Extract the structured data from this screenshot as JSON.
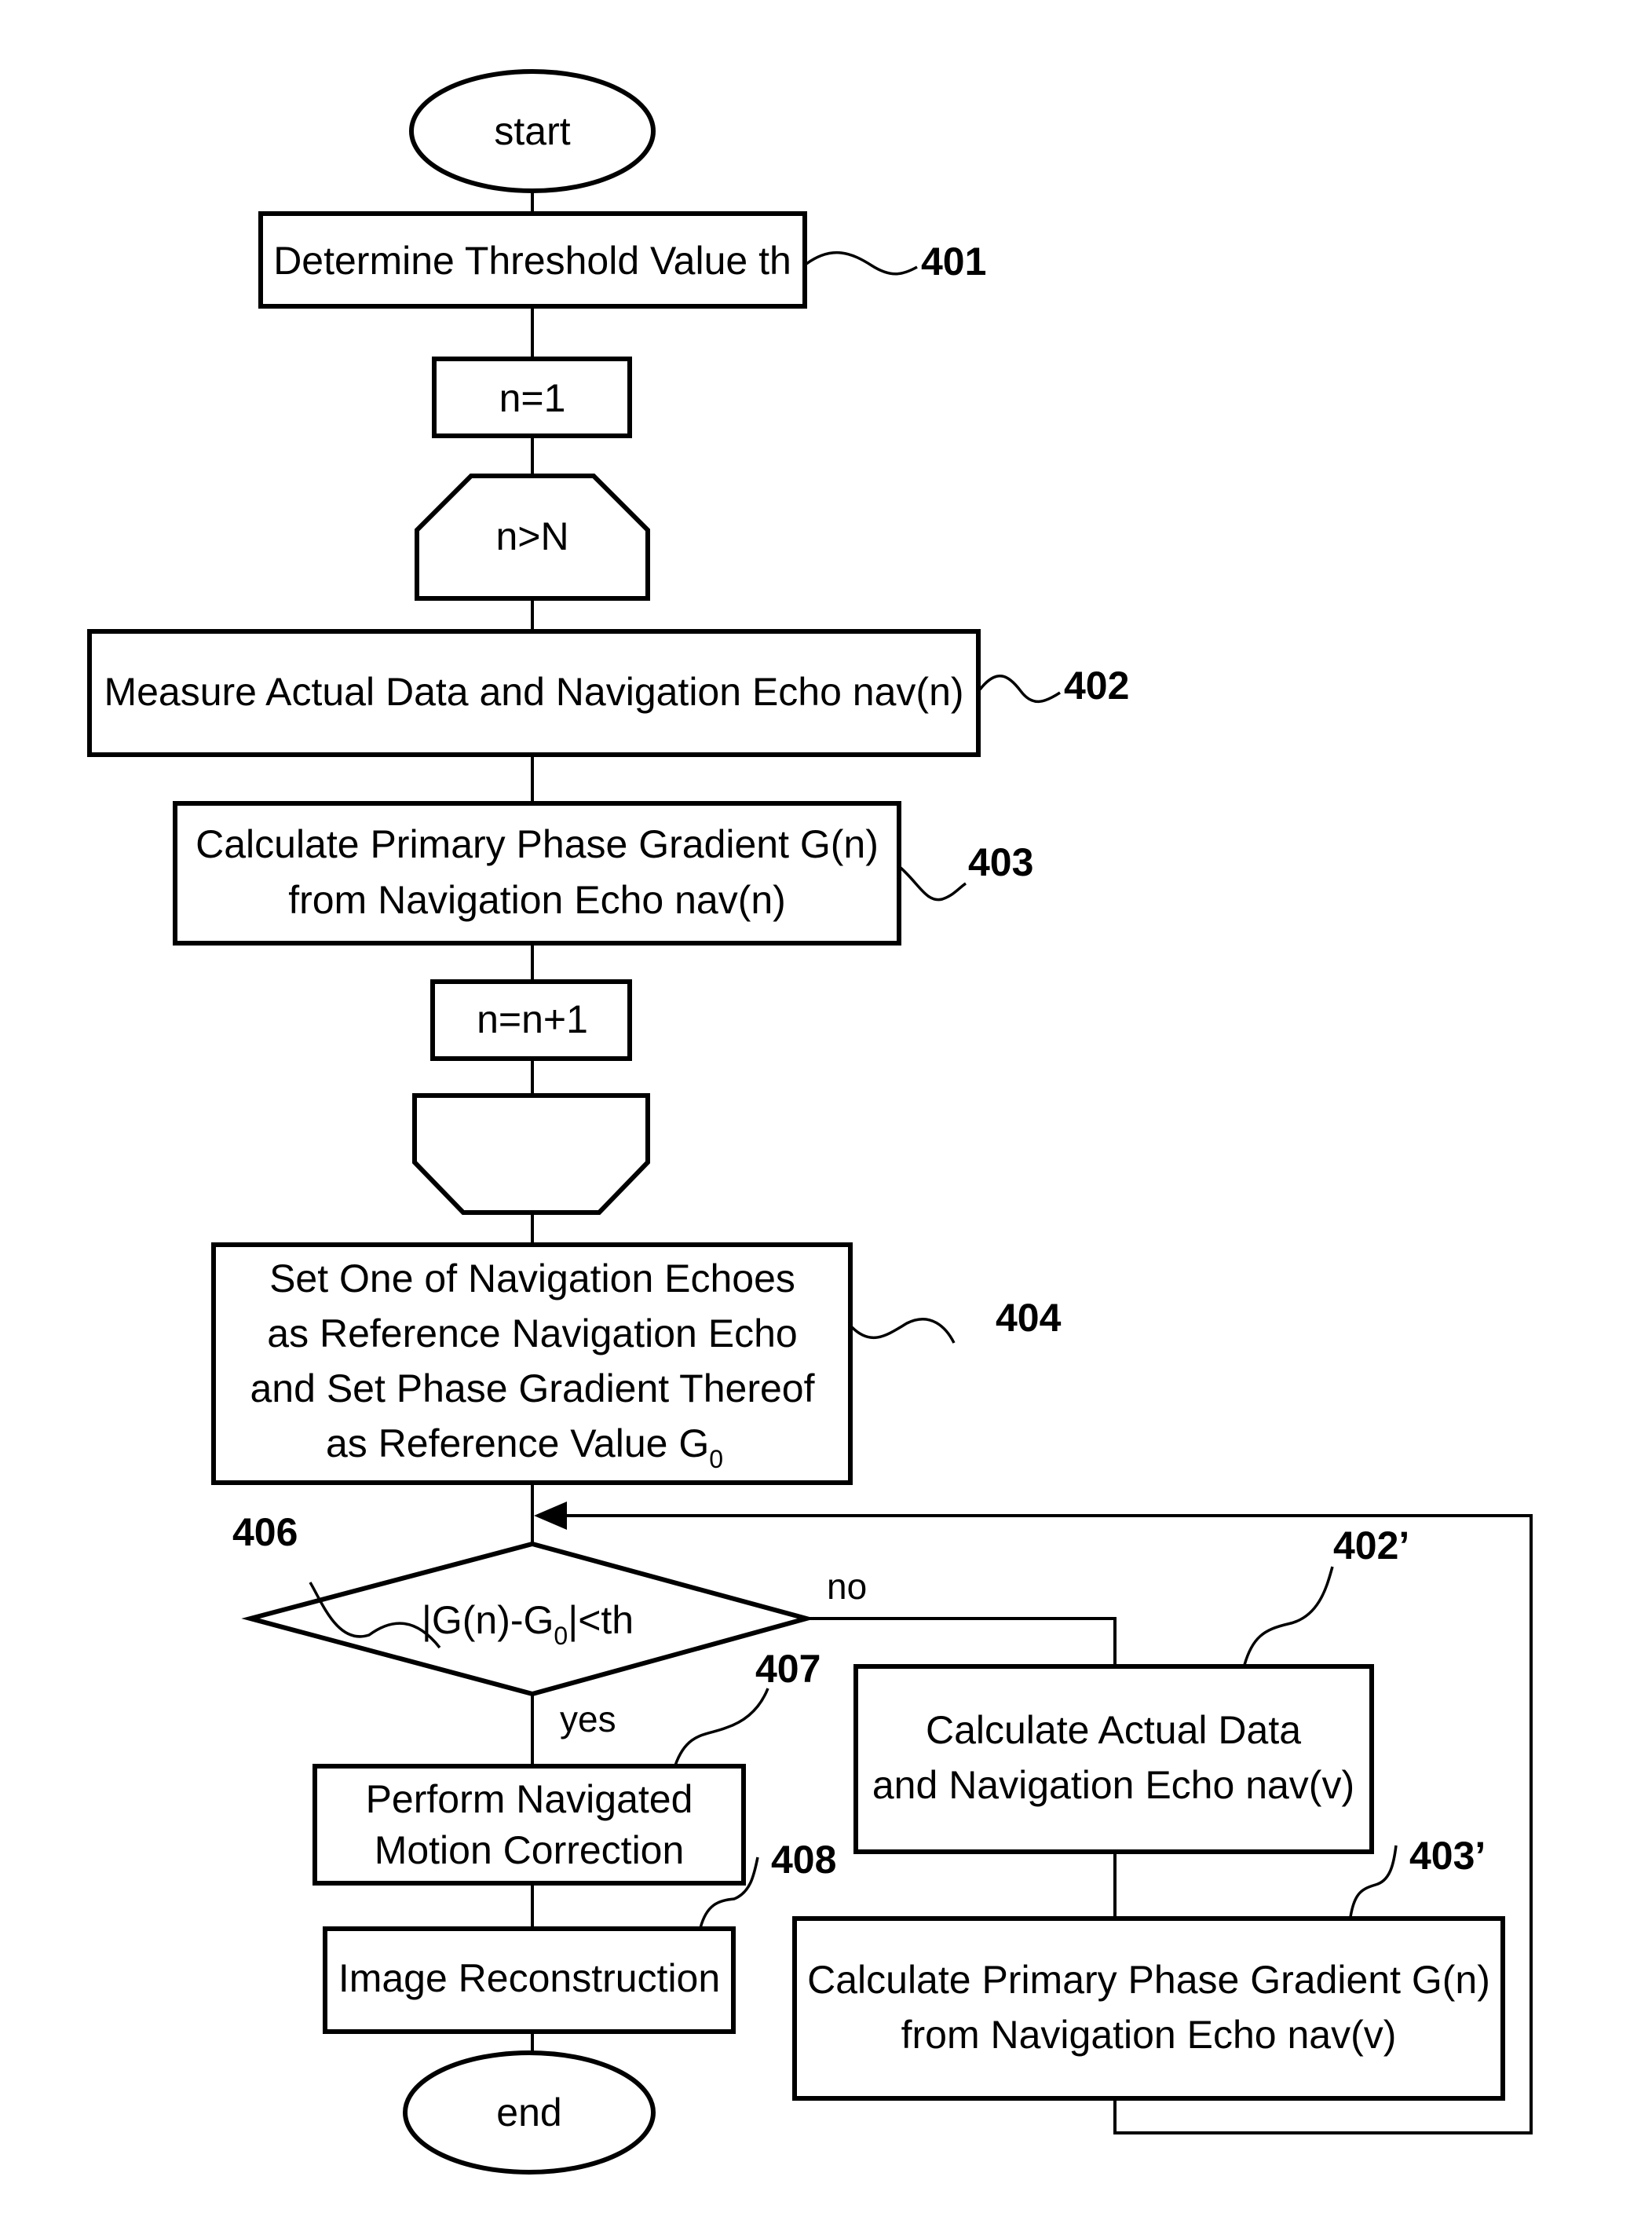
{
  "diagram": {
    "type": "flowchart",
    "colors": {
      "stroke": "#000000",
      "background": "#ffffff"
    },
    "nodes": {
      "start": {
        "text": "start"
      },
      "s401": {
        "lines": [
          "Determine Threshold Value th"
        ],
        "ref": "401"
      },
      "n_init": {
        "text": "n=1"
      },
      "loop_start": {
        "text": "n>N"
      },
      "s402": {
        "lines": [
          "Measure Actual Data and Navigation Echo nav(n)"
        ],
        "ref": "402"
      },
      "s403": {
        "lines": [
          "Calculate Primary Phase Gradient G(n)",
          "from Navigation Echo nav(n)"
        ],
        "ref": "403"
      },
      "n_inc": {
        "text": "n=n+1"
      },
      "loop_end": {
        "text": ""
      },
      "s404": {
        "lines": [
          "Set One of Navigation Echoes",
          "as Reference Navigation Echo",
          "and Set Phase Gradient Thereof",
          "as Reference Value G"
        ],
        "subscript": "0",
        "ref": "404"
      },
      "s406": {
        "prefix": "|G(n)-G",
        "subscript": "0",
        "suffix": "|<th",
        "ref": "406"
      },
      "s407": {
        "lines": [
          "Perform Navigated",
          "Motion Correction"
        ],
        "ref": "407"
      },
      "s408": {
        "lines": [
          "Image Reconstruction"
        ],
        "ref": "408"
      },
      "end": {
        "text": "end"
      },
      "s402p": {
        "lines": [
          "Calculate Actual Data",
          "and Navigation Echo nav(v)"
        ],
        "ref": "402’"
      },
      "s403p": {
        "lines": [
          "Calculate Primary Phase Gradient G(n)",
          "from Navigation Echo nav(v)"
        ],
        "ref": "403’"
      }
    },
    "branches": {
      "yes": "yes",
      "no": "no"
    }
  }
}
